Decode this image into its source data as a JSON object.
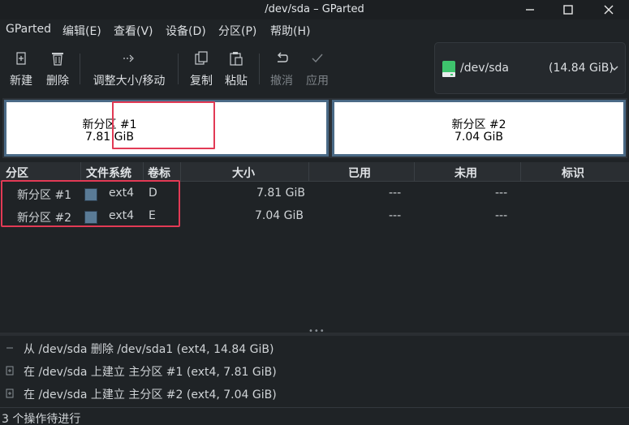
{
  "window": {
    "title": "/dev/sda  –  GParted"
  },
  "menu": {
    "items": [
      "GParted",
      "编辑(E)",
      "查看(V)",
      "设备(D)",
      "分区(P)",
      "帮助(H)"
    ]
  },
  "toolbar": {
    "new_label": "新建",
    "delete_label": "删除",
    "resize_label": "调整大小/移动",
    "copy_label": "复制",
    "paste_label": "粘贴",
    "undo_label": "撤消",
    "apply_label": "应用"
  },
  "device": {
    "name": "/dev/sda",
    "size": "(14.84  GiB)",
    "icon": "drive-icon",
    "icon_color": "#3ec46d"
  },
  "diskmap": {
    "partitions": [
      {
        "name": "新分区  #1",
        "size": "7.81  GiB"
      },
      {
        "name": "新分区  #2",
        "size": "7.04  GiB"
      }
    ],
    "highlight_color": "#e23a55",
    "border_color": "#4a6a86"
  },
  "table": {
    "headers": [
      "分区",
      "文件系统",
      "卷标",
      "大小",
      "已用",
      "未用",
      "标识"
    ],
    "rows": [
      {
        "partition": "新分区  #1",
        "filesystem": "ext4",
        "label": "D",
        "size": "7.81  GiB",
        "used": "---",
        "unused": "---",
        "flags": ""
      },
      {
        "partition": "新分区  #2",
        "filesystem": "ext4",
        "label": "E",
        "size": "7.04  GiB",
        "used": "---",
        "unused": "---",
        "flags": ""
      }
    ],
    "fs_color": "#5a7b96"
  },
  "operations": {
    "items": [
      "从  /dev/sda  删除  /dev/sda1  (ext4,  14.84  GiB)",
      "在  /dev/sda  上建立  主分区  #1  (ext4,  7.81  GiB)",
      "在  /dev/sda  上建立  主分区  #2  (ext4,  7.04  GiB)"
    ]
  },
  "status": {
    "text": "3  个操作待进行"
  }
}
